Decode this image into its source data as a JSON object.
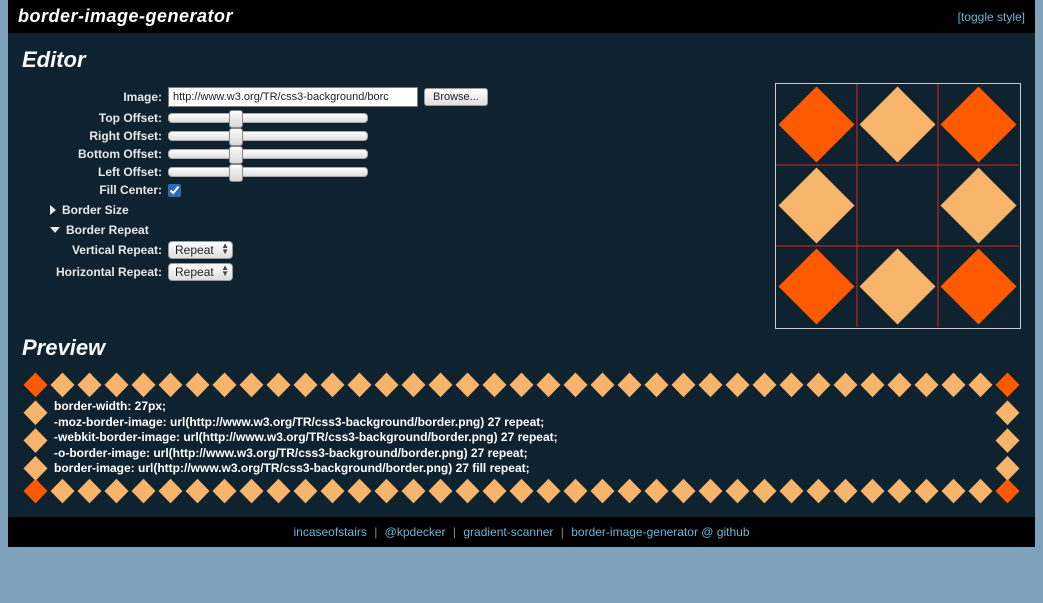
{
  "header": {
    "title": "border-image-generator",
    "toggle": "[toggle style]"
  },
  "editor": {
    "title": "Editor",
    "fields": {
      "image_label": "Image:",
      "image_value": "http://www.w3.org/TR/css3-background/borc",
      "browse": "Browse...",
      "top_label": "Top Offset:",
      "right_label": "Right Offset:",
      "bottom_label": "Bottom Offset:",
      "left_label": "Left Offset:",
      "fill_label": "Fill Center:",
      "fill_checked": true
    },
    "groups": {
      "border_size": "Border Size",
      "border_repeat": "Border Repeat",
      "vrepeat_label": "Vertical Repeat:",
      "vrepeat_value": "Repeat",
      "hrepeat_label": "Horizontal Repeat:",
      "hrepeat_value": "Repeat"
    }
  },
  "preview": {
    "title": "Preview",
    "css_lines": [
      "border-width: 27px;",
      "-moz-border-image: url(http://www.w3.org/TR/css3-background/border.png) 27 repeat;",
      "-webkit-border-image: url(http://www.w3.org/TR/css3-background/border.png) 27 repeat;",
      "-o-border-image: url(http://www.w3.org/TR/css3-background/border.png) 27 repeat;",
      "border-image: url(http://www.w3.org/TR/css3-background/border.png) 27 fill repeat;"
    ]
  },
  "footer": {
    "links": [
      "incaseofstairs",
      "@kpdecker",
      "gradient-scanner",
      "border-image-generator @ github"
    ]
  },
  "colors": {
    "dark_orange": "#ff5a00",
    "light_orange": "#f6b56a",
    "grid_red": "#e02020"
  }
}
